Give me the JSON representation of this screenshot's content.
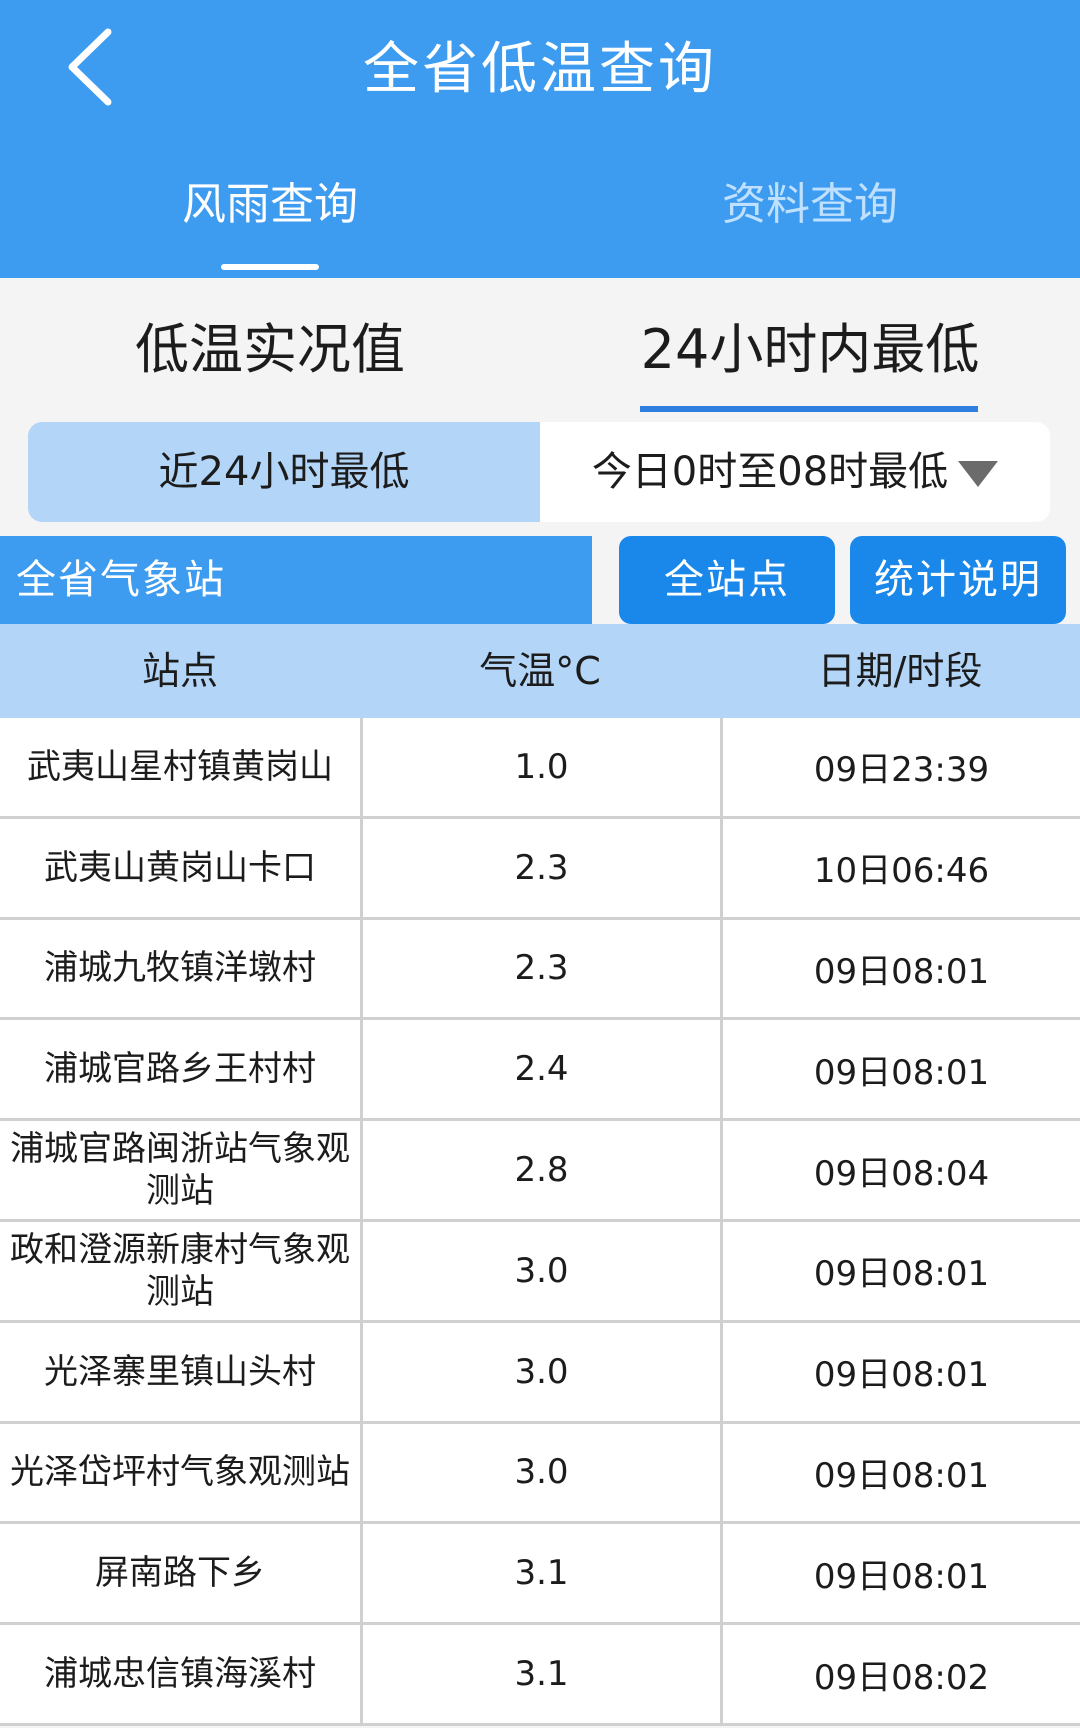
{
  "header": {
    "title": "全省低温查询",
    "tabs": [
      {
        "label": "风雨查询",
        "active": true
      },
      {
        "label": "资料查询",
        "active": false
      }
    ]
  },
  "subtabs": [
    {
      "label": "低温实况值",
      "active": false
    },
    {
      "label": "24小时内最低",
      "active": true
    }
  ],
  "segment": {
    "left": "近24小时最低",
    "right": "今日0时至08时最低"
  },
  "filter": {
    "region": "全省气象站",
    "all_stations_button": "全站点",
    "stats_button": "统计说明"
  },
  "table": {
    "headers": [
      "站点",
      "气温°C",
      "日期/时段"
    ],
    "rows": [
      {
        "station": "武夷山星村镇黄岗山",
        "temp": "1.0",
        "time": "09日23:39"
      },
      {
        "station": "武夷山黄岗山卡口",
        "temp": "2.3",
        "time": "10日06:46"
      },
      {
        "station": "浦城九牧镇洋墩村",
        "temp": "2.3",
        "time": "09日08:01"
      },
      {
        "station": "浦城官路乡王村村",
        "temp": "2.4",
        "time": "09日08:01"
      },
      {
        "station": "浦城官路闽浙站气象观测站",
        "temp": "2.8",
        "time": "09日08:04"
      },
      {
        "station": "政和澄源新康村气象观测站",
        "temp": "3.0",
        "time": "09日08:01"
      },
      {
        "station": "光泽寨里镇山头村",
        "temp": "3.0",
        "time": "09日08:01"
      },
      {
        "station": "光泽岱坪村气象观测站",
        "temp": "3.0",
        "time": "09日08:01"
      },
      {
        "station": "屏南路下乡",
        "temp": "3.1",
        "time": "09日08:01"
      },
      {
        "station": "浦城忠信镇海溪村",
        "temp": "3.1",
        "time": "09日08:02"
      }
    ]
  },
  "colors": {
    "header_bg": "#3d9cf0",
    "button_bg": "#1a88ea",
    "light_blue": "#b3d5f8",
    "active_underline": "#2f7fe0"
  }
}
